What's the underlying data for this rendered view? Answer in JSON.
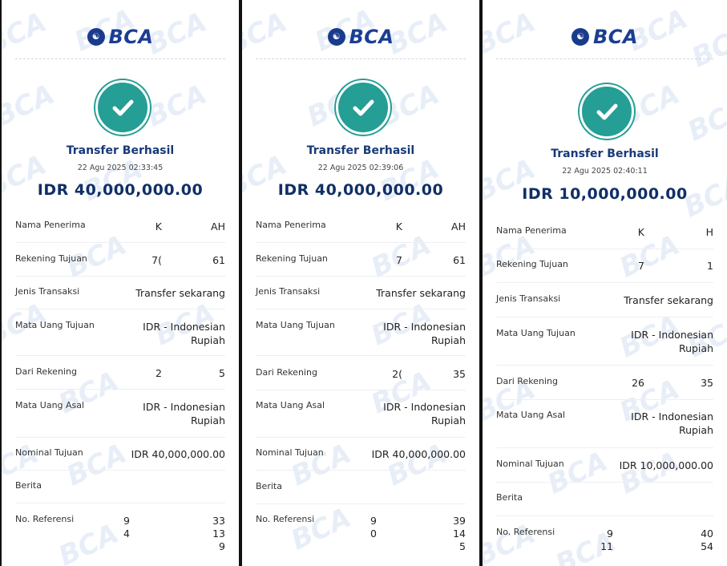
{
  "brand": {
    "name": "BCA"
  },
  "watermark_text": "BCA",
  "colors": {
    "brand": "#1b3e92",
    "success": "#259e95",
    "amount": "#102f66"
  },
  "receipts": [
    {
      "status": "Transfer Berhasil",
      "datetime": "22 Agu 2025 02:33:45",
      "amount": "IDR 40,000,000.00",
      "fields": {
        "nama_penerima": {
          "label": "Nama Penerima",
          "left": "K",
          "right": "AH"
        },
        "rekening_tujuan": {
          "label": "Rekening Tujuan",
          "left": "7(",
          "right": "61"
        },
        "jenis_transaksi": {
          "label": "Jenis Transaksi",
          "value": "Transfer sekarang"
        },
        "mata_uang_tujuan": {
          "label": "Mata Uang Tujuan",
          "value": "IDR - Indonesian Rupiah"
        },
        "dari_rekening": {
          "label": "Dari Rekening",
          "left": "2",
          "right": "5"
        },
        "mata_uang_asal": {
          "label": "Mata Uang Asal",
          "value": "IDR - Indonesian Rupiah"
        },
        "nominal_tujuan": {
          "label": "Nominal Tujuan",
          "value": "IDR 40,000,000.00"
        },
        "berita": {
          "label": "Berita",
          "value": ""
        },
        "no_referensi": {
          "label": "No. Referensi",
          "l1": "9",
          "r1": "33",
          "l2": "4",
          "r2": "13",
          "r3": "9"
        }
      }
    },
    {
      "status": "Transfer Berhasil",
      "datetime": "22 Agu 2025 02:39:06",
      "amount": "IDR 40,000,000.00",
      "fields": {
        "nama_penerima": {
          "label": "Nama Penerima",
          "left": "K",
          "right": "AH"
        },
        "rekening_tujuan": {
          "label": "Rekening Tujuan",
          "left": "7",
          "right": "61"
        },
        "jenis_transaksi": {
          "label": "Jenis Transaksi",
          "value": "Transfer sekarang"
        },
        "mata_uang_tujuan": {
          "label": "Mata Uang Tujuan",
          "value": "IDR - Indonesian Rupiah"
        },
        "dari_rekening": {
          "label": "Dari Rekening",
          "left": "2(",
          "right": "35"
        },
        "mata_uang_asal": {
          "label": "Mata Uang Asal",
          "value": "IDR - Indonesian Rupiah"
        },
        "nominal_tujuan": {
          "label": "Nominal Tujuan",
          "value": "IDR 40,000,000.00"
        },
        "berita": {
          "label": "Berita",
          "value": ""
        },
        "no_referensi": {
          "label": "No. Referensi",
          "l1": "9",
          "r1": "39",
          "l2": "0",
          "r2": "14",
          "r3": "5"
        }
      }
    },
    {
      "status": "Transfer Berhasil",
      "datetime": "22 Agu 2025 02:40:11",
      "amount": "IDR 10,000,000.00",
      "fields": {
        "nama_penerima": {
          "label": "Nama Penerima",
          "left": "K",
          "right": "H"
        },
        "rekening_tujuan": {
          "label": "Rekening Tujuan",
          "left": "7",
          "right": "1"
        },
        "jenis_transaksi": {
          "label": "Jenis Transaksi",
          "value": "Transfer sekarang"
        },
        "mata_uang_tujuan": {
          "label": "Mata Uang Tujuan",
          "value": "IDR - Indonesian Rupiah"
        },
        "dari_rekening": {
          "label": "Dari Rekening",
          "left": "26",
          "right": "35"
        },
        "mata_uang_asal": {
          "label": "Mata Uang Asal",
          "value": "IDR - Indonesian Rupiah"
        },
        "nominal_tujuan": {
          "label": "Nominal Tujuan",
          "value": "IDR 10,000,000.00"
        },
        "berita": {
          "label": "Berita",
          "value": ""
        },
        "no_referensi": {
          "label": "No. Referensi",
          "l1": "9",
          "r1": "40",
          "l2": "11",
          "r2": "54"
        }
      }
    }
  ]
}
